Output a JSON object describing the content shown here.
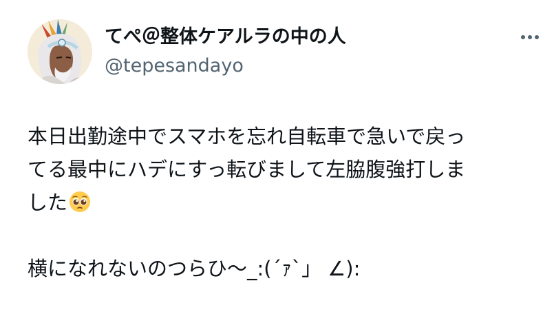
{
  "author": {
    "display_name": "てぺ＠整体ケアルラの中の人",
    "handle": "@tepesandayo",
    "avatar_icon": "avatar-illustration-icon"
  },
  "more_icon": "more-dots-icon",
  "tweet": {
    "line1": "本日出勤途中でスマホを忘れ自転車で急いで戻っ",
    "line2": "てる最中にハデにすっ転びまして左脇腹強打しま",
    "line3": "した",
    "line3_emoji": "pleading-face-emoji",
    "line4": "横になれないのつらひ〜_:(´ｧ`」 ∠):"
  },
  "colors": {
    "text": "#0f1419",
    "secondary": "#536471",
    "background": "#ffffff"
  }
}
